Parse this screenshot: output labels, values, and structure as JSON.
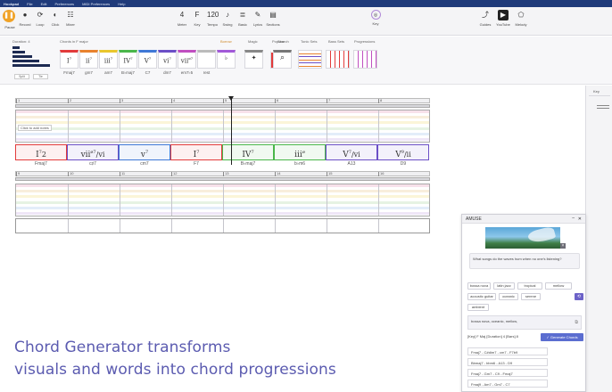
{
  "menubar": {
    "items": [
      "Hookpad",
      "File",
      "Edit",
      "Preferences",
      "MIDI Preferences",
      "Help"
    ]
  },
  "toolbar": {
    "left_buttons": [
      {
        "label": "Pause",
        "icon": "pause-icon"
      },
      {
        "label": "Record",
        "icon": "record-icon"
      },
      {
        "label": "Loop",
        "icon": "loop-icon"
      },
      {
        "label": "Click",
        "icon": "click-icon"
      },
      {
        "label": "Mixer",
        "icon": "mixer-icon"
      }
    ],
    "center_buttons": [
      {
        "label": "Meter",
        "value": "4"
      },
      {
        "label": "Key",
        "value": "F"
      },
      {
        "label": "Tempo",
        "value": "120"
      },
      {
        "label": "Swing",
        "value": ""
      },
      {
        "label": "Basic",
        "value": ""
      },
      {
        "label": "Lyrics",
        "value": ""
      },
      {
        "label": "Sections",
        "value": ""
      }
    ],
    "mode_label": "Key",
    "right_buttons": [
      "Guides",
      "YouTube",
      "Melody"
    ]
  },
  "ribbon": {
    "duration_label": "Duration: 4",
    "chords_label": "Chords in F major",
    "chords": [
      {
        "numeral": "I",
        "sup": "7",
        "name": "Fmaj7",
        "color": "#e23b3b"
      },
      {
        "numeral": "ii",
        "sup": "7",
        "name": "gm7",
        "color": "#e8822d"
      },
      {
        "numeral": "iii",
        "sup": "7",
        "name": "am7",
        "color": "#e9c62c"
      },
      {
        "numeral": "IV",
        "sup": "7",
        "name": "B♭maj7",
        "color": "#4ab64a"
      },
      {
        "numeral": "V",
        "sup": "7",
        "name": "C7",
        "color": "#3f78d6"
      },
      {
        "numeral": "vi",
        "sup": "7",
        "name": "dm7",
        "color": "#6b4fc6"
      },
      {
        "numeral": "vii",
        "sup": "ø7",
        "name": "em7♭5",
        "color": "#c04fc0"
      },
      {
        "numeral": "",
        "sup": "",
        "name": "rest",
        "color": "#bbbbbb"
      }
    ],
    "groups": [
      "Borrow",
      "Magic",
      "Popular",
      "Search",
      "Tonic Sets",
      "Bass Sets",
      "Progressions"
    ],
    "split_label": "Split",
    "tie_label": "Tie"
  },
  "canvas": {
    "measure_numbers_row1": [
      "1",
      "2",
      "3",
      "4",
      "5",
      "6",
      "7",
      "8"
    ],
    "measure_numbers_row2": [
      "9",
      "10",
      "11",
      "12",
      "13",
      "14",
      "15",
      "16"
    ],
    "click_hint": "Click to add notes",
    "progression": [
      {
        "numeral": "I",
        "sup": "7",
        "sub": "2",
        "name": "Fmaj7",
        "color": "#e23b3b"
      },
      {
        "numeral": "vii",
        "sup": "ø7",
        "sub": "/vi",
        "name": "c♯7",
        "color": "#6b4fc6"
      },
      {
        "numeral": "v",
        "sup": "7",
        "sub": "",
        "name": "cm7",
        "color": "#3f78d6"
      },
      {
        "numeral": "I",
        "sup": "7",
        "sub": "",
        "name": "F7",
        "color": "#e23b3b"
      },
      {
        "numeral": "IV",
        "sup": "7",
        "sub": "",
        "name": "B♭maj7",
        "color": "#4ab64a"
      },
      {
        "numeral": "iii",
        "sup": "ø",
        "sub": "",
        "name": "b♭m6",
        "color": "#4ab64a"
      },
      {
        "numeral": "V",
        "sup": "7",
        "sub": "/vi",
        "name": "A13",
        "color": "#6b4fc6"
      },
      {
        "numeral": "V",
        "sup": "9",
        "sub": "/ii",
        "name": "D9",
        "color": "#6b4fc6"
      }
    ]
  },
  "side_panel": {
    "label": "Key"
  },
  "amuse": {
    "title": "AMUSE",
    "prompt": "What songs do the waves hum when no one's listening?",
    "tags": [
      "bossa nova",
      "latin jazz",
      "tropical",
      "mellow",
      "acoustic guitar",
      "oceanic",
      "serene",
      "ambient"
    ],
    "tags_input": "bossa nova, oceanic, mellow,",
    "key_row": "[Key] F Maj  [Duration] 4  [Bars] 8",
    "generate_label": "✓ Generate Chords",
    "results": [
      "Fmaj7 - C#dim7 - cm7 - F7b9",
      "Bbmaj7 - bbm6 - A13 - D9",
      "Fmaj7 - Gm7 - C9 - Fmaj7",
      "Fmaj9 - Am7 - Gm7 - C7"
    ]
  },
  "caption": {
    "line1": "Chord Generator transforms",
    "line2": "visuals and words into chord progressions"
  },
  "colors": {
    "menubar": "#1f3a7a",
    "accent": "#f0a227",
    "caption": "#5b5bb0",
    "generate": "#5b6dd0"
  }
}
